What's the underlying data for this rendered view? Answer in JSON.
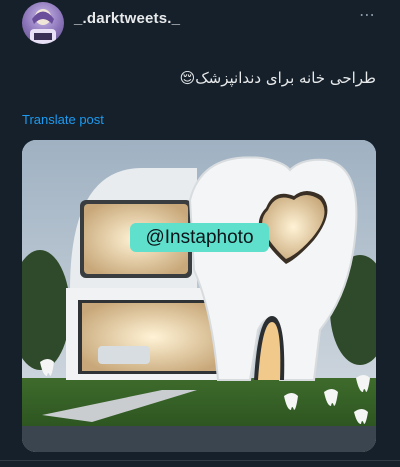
{
  "post": {
    "username": "_.darktweets._",
    "more_icon": "⋯",
    "text": "طراحی خانه برای دندانپزشک😌",
    "translate_label": "Translate post",
    "media_watermark": "@Instaphoto"
  },
  "icons": {
    "more": "more-horizontal-icon",
    "avatar": "avatar-image"
  },
  "colors": {
    "background": "#15202b",
    "link": "#1d9bf0",
    "watermark_bg": "#5ee0cc"
  }
}
